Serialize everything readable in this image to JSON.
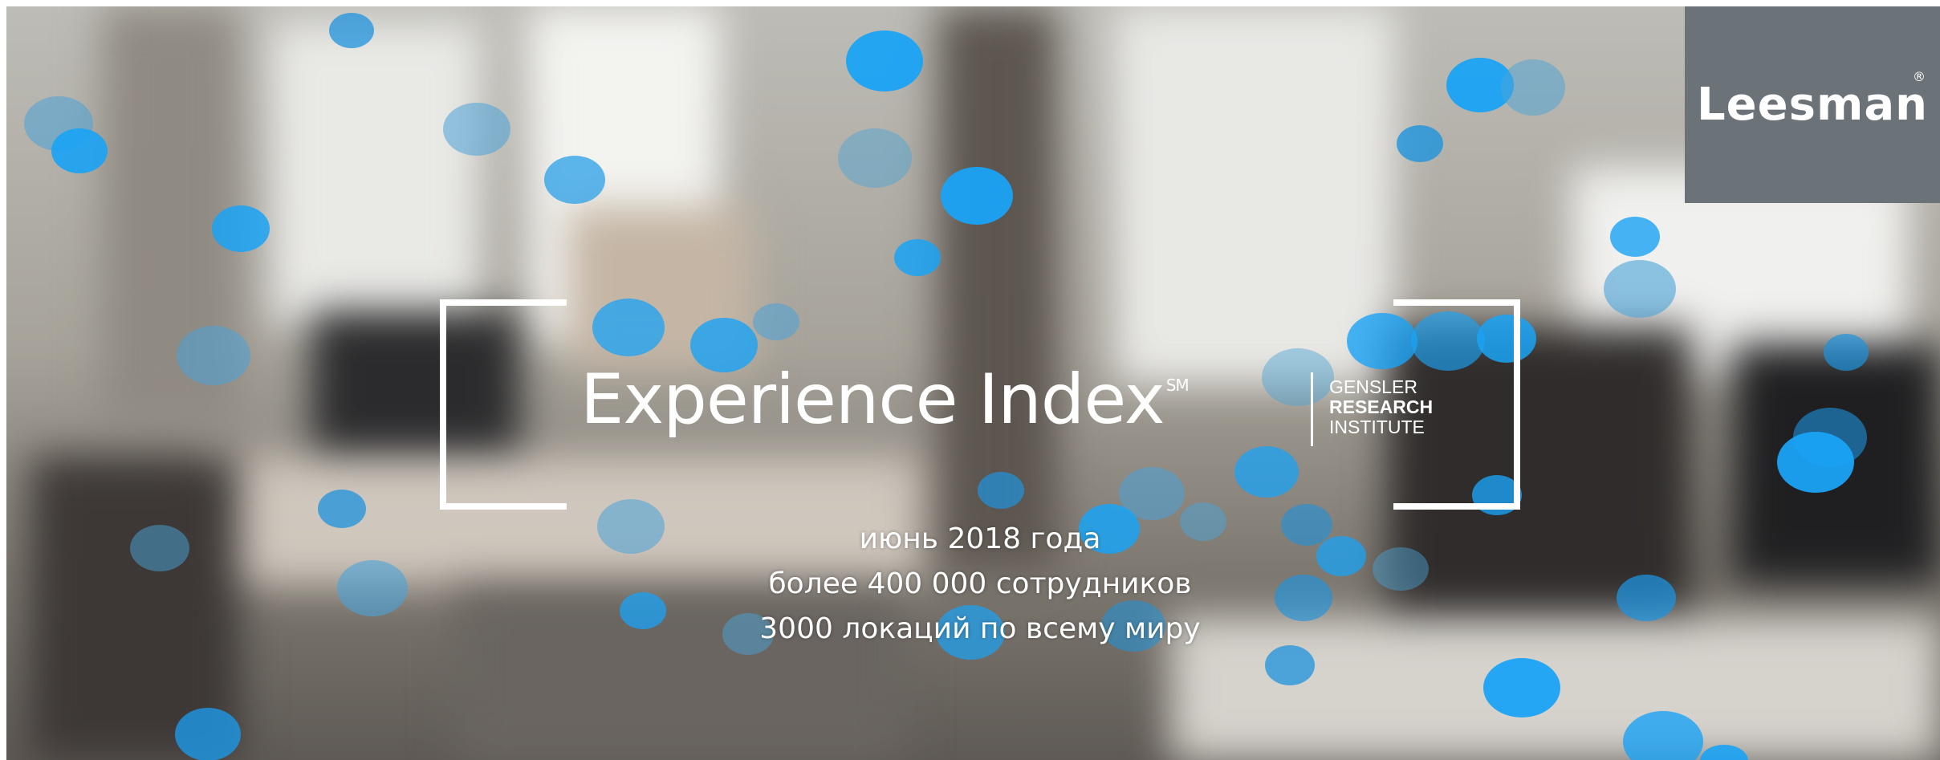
{
  "brand": {
    "logo_text": "Leesman",
    "registered_mark": "®"
  },
  "hero": {
    "title": "Experience Index",
    "title_mark": "SM",
    "partner": {
      "line1": "GENSLER",
      "line2": "RESEARCH",
      "line3": "INSTITUTE"
    }
  },
  "details": [
    "июнь 2018 года",
    "более 400 000 сотрудников",
    "3000 локаций по всему миру"
  ],
  "colors": {
    "accent_blue": "#1aa3f5",
    "logo_panel": "#6c7378",
    "text": "#ffffff"
  }
}
